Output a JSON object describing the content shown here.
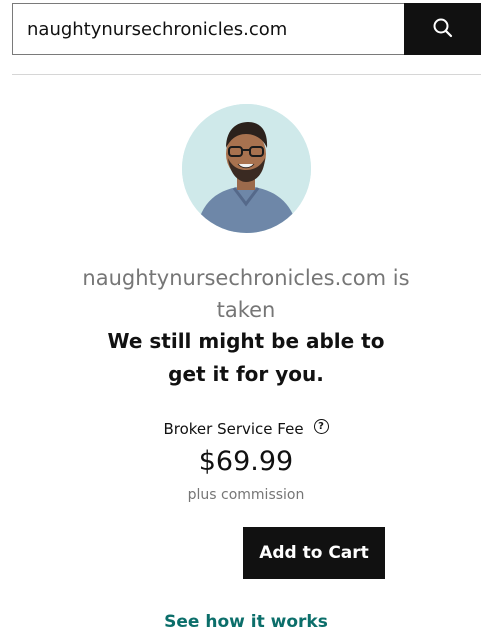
{
  "search": {
    "value": "naughtynursechronicles.com",
    "icon": "search-icon"
  },
  "result": {
    "taken_text": "naughtynursechronicles.com is taken",
    "subheading": "We still might be able to get it for you."
  },
  "broker": {
    "label": "Broker Service Fee",
    "help_icon": "question-circle-icon",
    "help_glyph": "?",
    "price": "$69.99",
    "note": "plus commission"
  },
  "actions": {
    "add_to_cart": "Add to Cart",
    "see_how": "See how it works"
  },
  "colors": {
    "accent_link": "#0b6e6a",
    "button_bg": "#111111",
    "avatar_bg": "#cfe9ea"
  }
}
